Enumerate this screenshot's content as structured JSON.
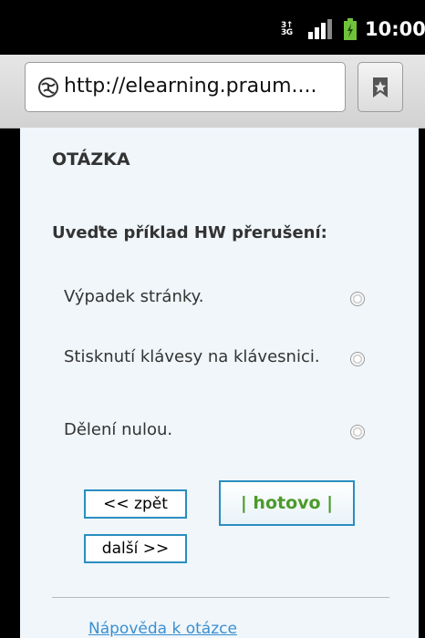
{
  "status_bar": {
    "network_label": "3G",
    "time": "10:00"
  },
  "browser": {
    "url": "http://elearning.praum...."
  },
  "quiz": {
    "heading": "OTÁZKA",
    "question": "Uveďte příklad HW přerušení:",
    "options": [
      {
        "label": "Výpadek stránky."
      },
      {
        "label": "Stisknutí klávesy na klávesnici."
      },
      {
        "label": "Dělení nulou."
      }
    ],
    "buttons": {
      "back": "<< zpět",
      "done": "| hotovo |",
      "next": "další >>"
    },
    "help_link": "Nápověda k otázce"
  }
}
